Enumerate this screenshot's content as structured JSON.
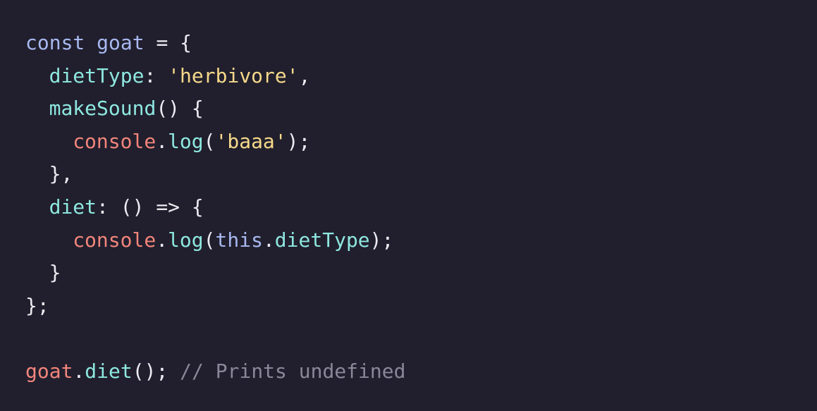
{
  "code": {
    "lines": [
      {
        "t": [
          "const",
          " ",
          "goat",
          " = {"
        ]
      },
      {
        "t": [
          "dietType",
          ": ",
          "'herbivore'",
          ","
        ]
      },
      {
        "t": [
          "makeSound",
          "() {"
        ]
      },
      {
        "t": [
          "console",
          ".",
          "log",
          "(",
          "'baaa'",
          ");"
        ]
      },
      {
        "t": [
          "},"
        ]
      },
      {
        "t": [
          "diet",
          ": () => {"
        ]
      },
      {
        "t": [
          "console",
          ".",
          "log",
          "(",
          "this",
          ".",
          "dietType",
          ");"
        ]
      },
      {
        "t": [
          "}"
        ]
      },
      {
        "t": [
          "};"
        ]
      },
      {
        "t": []
      },
      {
        "t": [
          "goat",
          ".",
          "diet",
          "(); ",
          "// Prints undefined"
        ]
      }
    ]
  },
  "colors": {
    "background": "#211f2d",
    "keyword": "#a8b8f0",
    "property": "#8ee8e0",
    "string": "#f6d98a",
    "object": "#f2857b",
    "comment": "#8a8898",
    "punctuation": "#ecebf2"
  }
}
